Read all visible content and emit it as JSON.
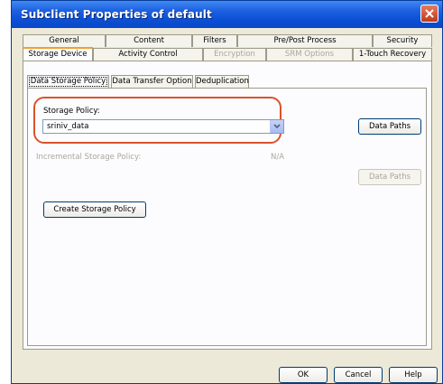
{
  "window": {
    "title": "Subclient Properties of default"
  },
  "tabs_row1": [
    {
      "label": "General"
    },
    {
      "label": "Content"
    },
    {
      "label": "Filters"
    },
    {
      "label": "Pre/Post Process"
    },
    {
      "label": "Security"
    }
  ],
  "tabs_row2": [
    {
      "label": "Storage Device",
      "state": "active"
    },
    {
      "label": "Activity Control",
      "state": "normal"
    },
    {
      "label": "Encryption",
      "state": "disabled"
    },
    {
      "label": "SRM Options",
      "state": "disabled"
    },
    {
      "label": "1-Touch Recovery",
      "state": "normal"
    }
  ],
  "subtabs": [
    {
      "label": "Data Storage Policy",
      "state": "active"
    },
    {
      "label": "Data Transfer Option",
      "state": "normal"
    },
    {
      "label": "Deduplication",
      "state": "normal"
    }
  ],
  "storage_policy": {
    "label": "Storage Policy:",
    "value": "sriniv_data",
    "data_paths_label": "Data Paths"
  },
  "incremental_policy": {
    "label": "Incremental Storage Policy:",
    "value": "N/A",
    "data_paths_label": "Data Paths"
  },
  "create_button_label": "Create Storage Policy",
  "footer": {
    "ok": "OK",
    "cancel": "Cancel",
    "help": "Help"
  },
  "colors": {
    "titlebar": "#0b4fd6",
    "highlight": "#d9532c",
    "active_tab_accent": "#f0a030"
  }
}
